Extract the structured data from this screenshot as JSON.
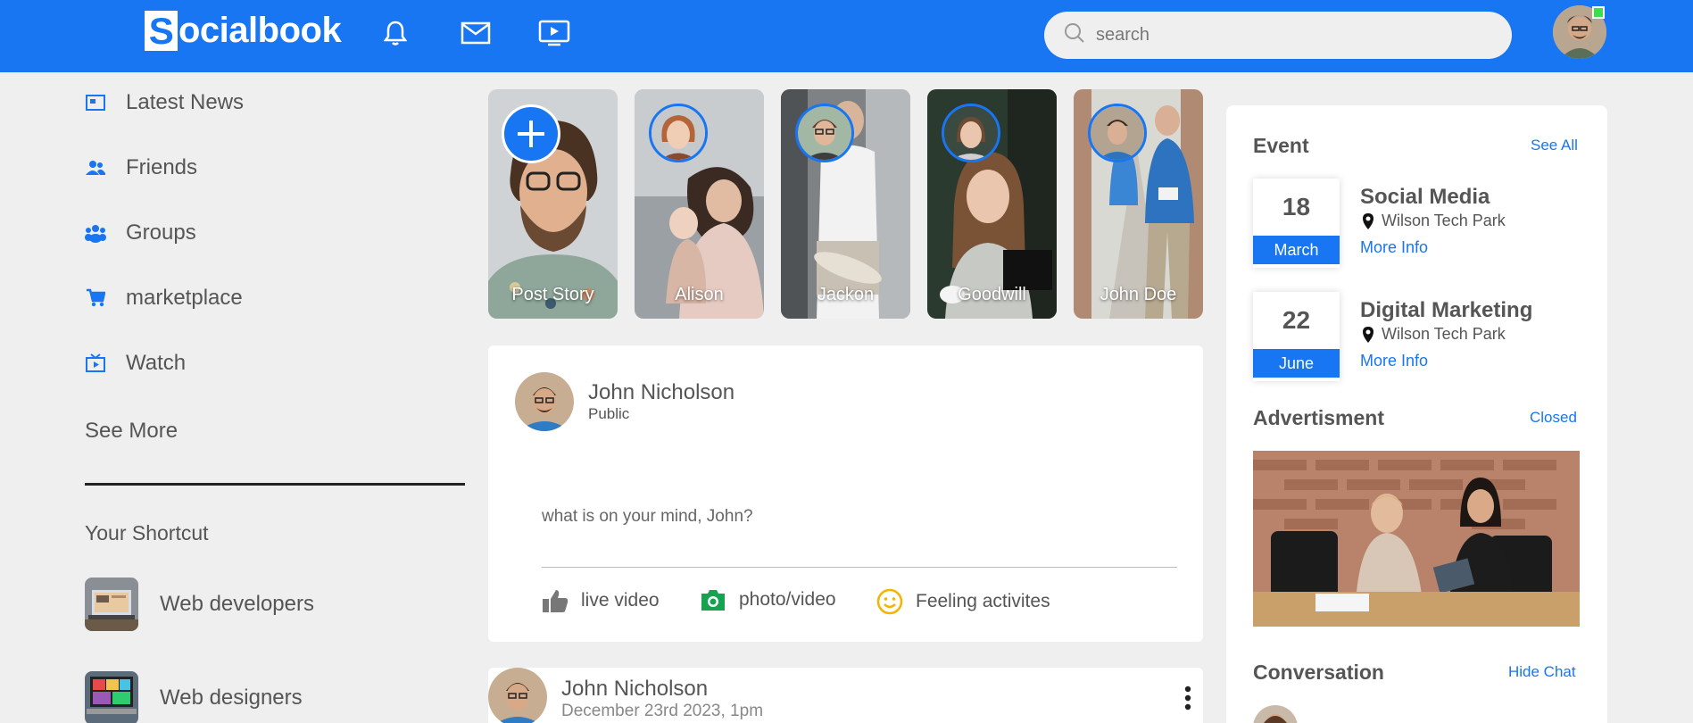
{
  "header": {
    "logo_letter": "S",
    "logo_rest": "ocialbook",
    "search_placeholder": "search",
    "brand_color": "#1876f2",
    "online_color": "#41db51"
  },
  "sidebar": {
    "items": [
      {
        "label": "Latest News",
        "icon": "news-icon"
      },
      {
        "label": "Friends",
        "icon": "friends-icon"
      },
      {
        "label": "Groups",
        "icon": "groups-icon"
      },
      {
        "label": "marketplace",
        "icon": "cart-icon"
      },
      {
        "label": "Watch",
        "icon": "watch-icon"
      }
    ],
    "see_more": "See More",
    "shortcut_title": "Your Shortcut",
    "shortcuts": [
      {
        "label": "Web developers"
      },
      {
        "label": "Web designers"
      }
    ]
  },
  "stories": [
    {
      "name": "Post Story"
    },
    {
      "name": "Alison"
    },
    {
      "name": "Jackon"
    },
    {
      "name": "Goodwill"
    },
    {
      "name": "John Doe"
    }
  ],
  "write_post": {
    "user_name": "John Nicholson",
    "privacy": "Public",
    "placeholder": "what is on your mind, John?",
    "actions": [
      {
        "label": "live video",
        "icon": "thumbs-up-icon"
      },
      {
        "label": "photo/video",
        "icon": "camera-icon"
      },
      {
        "label": "Feeling activites",
        "icon": "smiley-icon"
      }
    ]
  },
  "post": {
    "user_name": "John Nicholson",
    "date": "December 23rd 2023, 1pm"
  },
  "right": {
    "event_title": "Event",
    "see_all": "See All",
    "events": [
      {
        "day": "18",
        "month": "March",
        "title": "Social Media",
        "place": "Wilson Tech Park",
        "more": "More Info"
      },
      {
        "day": "22",
        "month": "June",
        "title": "Digital Marketing",
        "place": "Wilson Tech Park",
        "more": "More Info"
      }
    ],
    "ad_title": "Advertisment",
    "ad_link": "Closed",
    "conv_title": "Conversation",
    "conv_link": "Hide Chat"
  }
}
